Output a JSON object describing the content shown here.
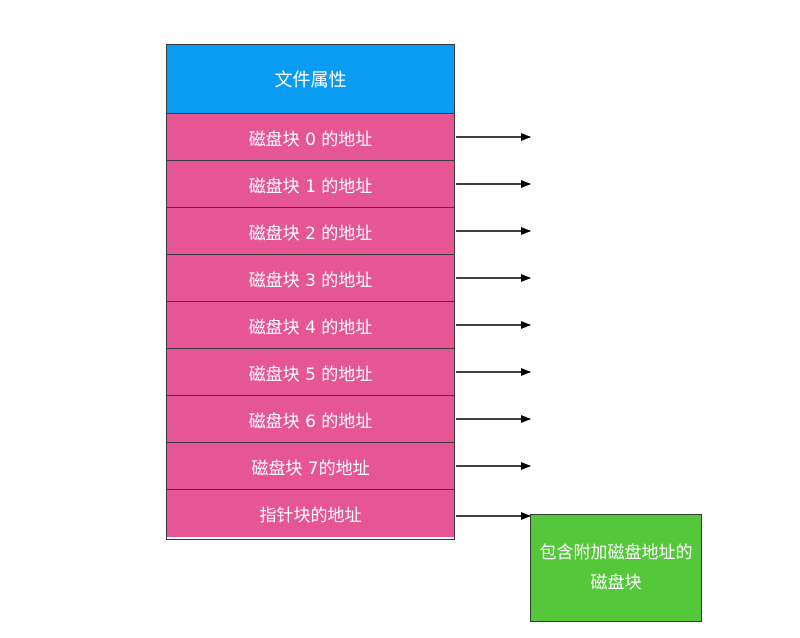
{
  "inode": {
    "header": "文件属性",
    "rows": [
      "磁盘块 0 的地址",
      "磁盘块 1 的地址",
      "磁盘块 2 的地址",
      "磁盘块 3 的地址",
      "磁盘块 4 的地址",
      "磁盘块 5 的地址",
      "磁盘块 6 的地址",
      "磁盘块 7的地址",
      "指针块的地址"
    ]
  },
  "extra_block": {
    "label": "包含附加磁盘地址的磁盘块"
  },
  "colors": {
    "header": "#0a9cf2",
    "row": "#e65694",
    "extra_block": "#54c83a",
    "border": "#3a3a3a",
    "text": "#ffffff"
  }
}
